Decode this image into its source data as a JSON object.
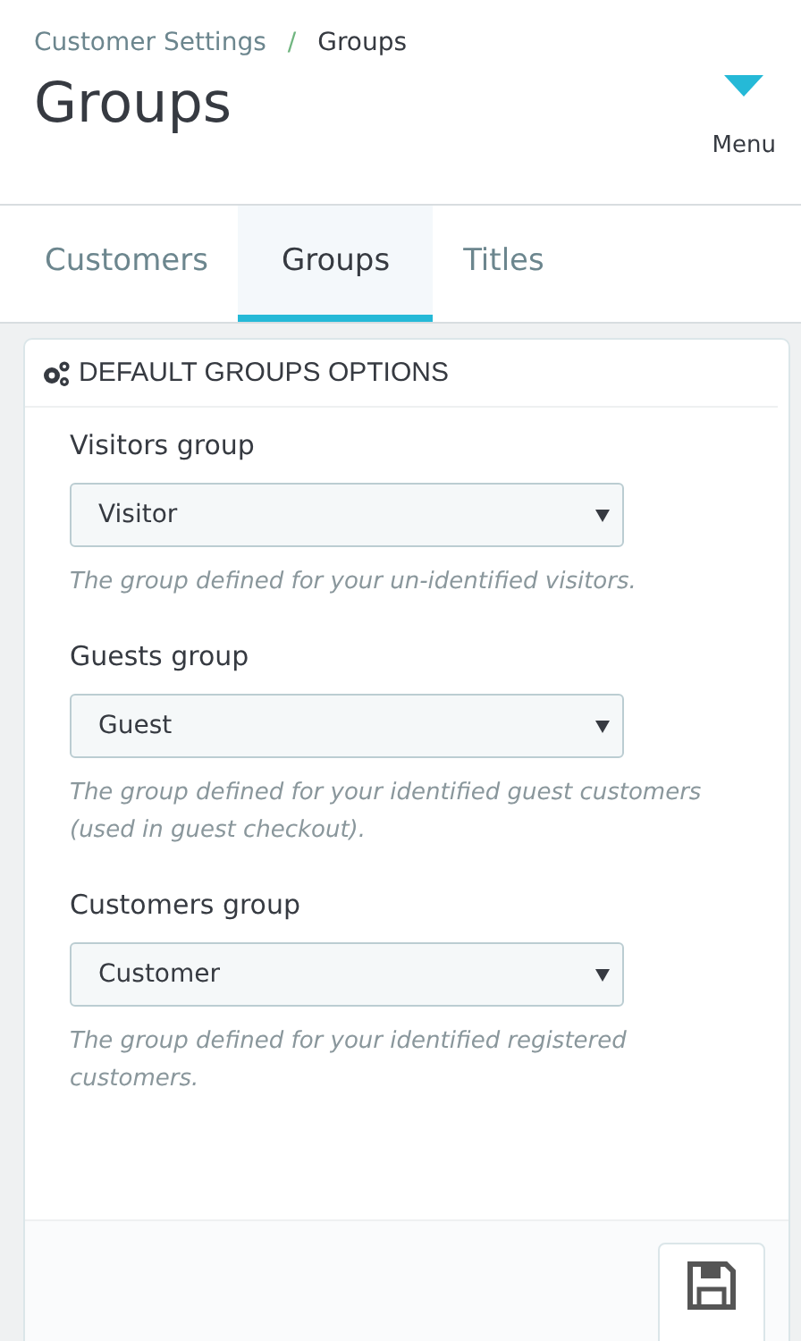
{
  "breadcrumb": {
    "parent": "Customer Settings",
    "separator": "/",
    "current": "Groups"
  },
  "page_title": "Groups",
  "menu": {
    "label": "Menu"
  },
  "tabs": [
    {
      "label": "Customers",
      "selected": false
    },
    {
      "label": "Groups",
      "selected": true
    },
    {
      "label": "Titles",
      "selected": false
    }
  ],
  "panel": {
    "title": "DEFAULT GROUPS OPTIONS",
    "fields": [
      {
        "label": "Visitors group",
        "value": "Visitor",
        "help": "The group defined for your un-identified visitors."
      },
      {
        "label": "Guests group",
        "value": "Guest",
        "help": "The group defined for your identified guest customers (used in guest checkout)."
      },
      {
        "label": "Customers group",
        "value": "Customer",
        "help": "The group defined for your identified registered customers."
      }
    ]
  }
}
